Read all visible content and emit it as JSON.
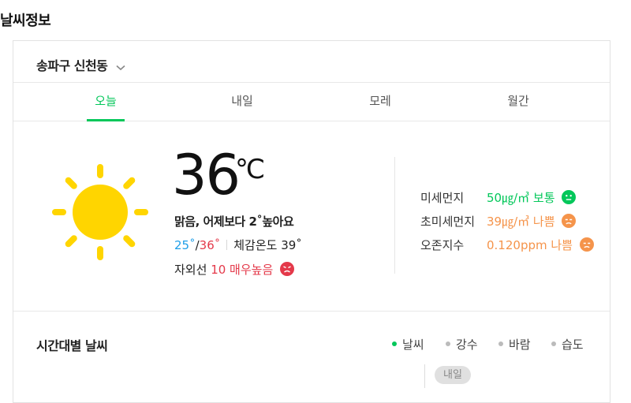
{
  "header": {
    "title": "날씨정보"
  },
  "location": {
    "name": "송파구 신천동"
  },
  "tabs": [
    {
      "label": "오늘",
      "active": true
    },
    {
      "label": "내일",
      "active": false
    },
    {
      "label": "모레",
      "active": false
    },
    {
      "label": "월간",
      "active": false
    }
  ],
  "current": {
    "icon": "sun-icon",
    "temperature": "36",
    "unit": "℃",
    "description": "맑음, 어제보다 2˚높아요",
    "min": "25˚",
    "slash": "/",
    "max": "36˚",
    "feels_like": "체감온도 39˚",
    "uv_label": "자외선",
    "uv_value": "10 매우높음"
  },
  "air_quality": [
    {
      "label": "미세먼지",
      "value": "50㎍/㎥ 보통",
      "status": "good",
      "color": "#03c75a"
    },
    {
      "label": "초미세먼지",
      "value": "39㎍/㎥ 나쁨",
      "status": "bad",
      "color": "#f5944b"
    },
    {
      "label": "오존지수",
      "value": "0.120ppm 나쁨",
      "status": "bad",
      "color": "#f5944b"
    }
  ],
  "hourly": {
    "title": "시간대별 날씨",
    "legend": [
      {
        "label": "날씨",
        "active": true
      },
      {
        "label": "강수",
        "active": false
      },
      {
        "label": "바람",
        "active": false
      },
      {
        "label": "습도",
        "active": false
      }
    ],
    "tomorrow_badge": "내일"
  },
  "colors": {
    "accent": "#03c75a",
    "sun": "#ffd500",
    "high": "#e4394a",
    "low": "#1e9ee8",
    "bad": "#f5944b"
  }
}
